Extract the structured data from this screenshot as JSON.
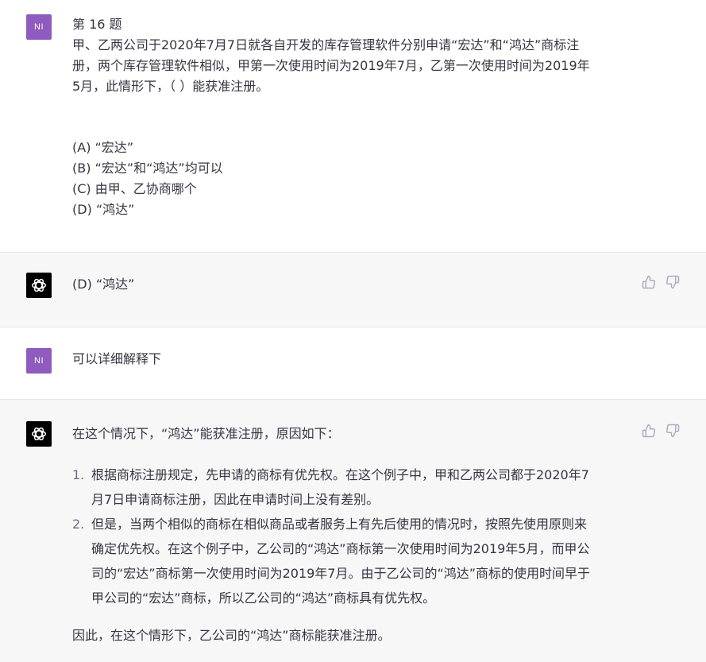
{
  "messages": [
    {
      "role": "user",
      "avatar_text": "NI",
      "lines": [
        "第 16 题",
        "甲、乙两公司于2020年7月7日就各自开发的库存管理软件分别申请“宏达”和“鸿达”商标注",
        "册，两个库存管理软件相似，甲第一次使用时间为2019年7月，乙第一次使用时间为2019年",
        "5月，此情形下，（   ）能获准注册。"
      ],
      "options": [
        "(A) “宏达”",
        "(B) “宏达”和“鸿达”均可以",
        "(C) 由甲、乙协商哪个",
        "(D) “鸿达”"
      ]
    },
    {
      "role": "assistant",
      "text": "(D) “鸿达”",
      "icons": [
        "thumbs-up-icon",
        "thumbs-down-icon"
      ]
    },
    {
      "role": "user",
      "avatar_text": "NI",
      "text": "可以详细解释下"
    },
    {
      "role": "assistant",
      "intro": "在这个情况下，“鸿达”能获准注册，原因如下：",
      "reasons": [
        {
          "num": "1.",
          "lines": [
            "根据商标注册规定，先申请的商标有优先权。在这个例子中，甲和乙两公司都于2020年7",
            "月7日申请商标注册，因此在申请时间上没有差别。"
          ]
        },
        {
          "num": "2.",
          "lines": [
            "但是，当两个相似的商标在相似商品或者服务上有先后使用的情况时，按照先使用原则来",
            "确定优先权。在这个例子中，乙公司的“鸿达”商标第一次使用时间为2019年5月，而甲公",
            "司的“宏达”商标第一次使用时间为2019年7月。由于乙公司的“鸿达”商标的使用时间早于",
            "甲公司的“宏达”商标，所以乙公司的“鸿达”商标具有优先权。"
          ]
        }
      ],
      "conclusion": "因此，在这个情形下，乙公司的“鸿达”商标能获准注册。",
      "icons": [
        "thumbs-up-icon",
        "thumbs-down-icon"
      ]
    }
  ],
  "colors": {
    "user_avatar": "#8e5bbf",
    "bot_avatar": "#000000",
    "bot_background": "#f7f7f8",
    "text": "#343541"
  }
}
